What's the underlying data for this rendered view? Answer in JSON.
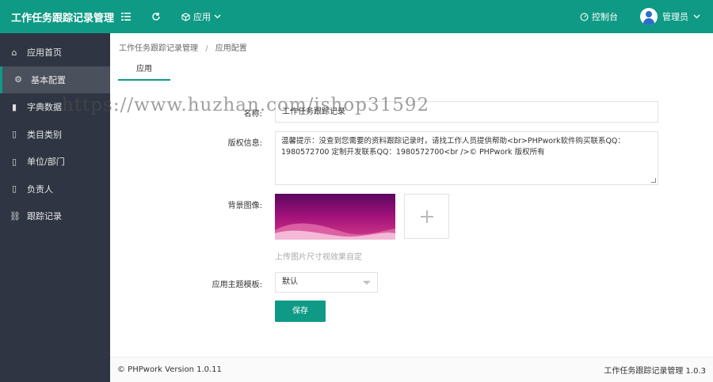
{
  "app": {
    "title": "工作任务跟踪记录管理"
  },
  "topbar": {
    "app_menu_label": "应用",
    "console_label": "控制台",
    "user_label": "管理员"
  },
  "sidebar": {
    "items": [
      {
        "label": "应用首页",
        "icon": "home-icon"
      },
      {
        "label": "基本配置",
        "icon": "gear-icon",
        "active": true
      },
      {
        "label": "字典数据",
        "icon": "book-icon"
      },
      {
        "label": "类目类别",
        "icon": "file-icon"
      },
      {
        "label": "单位/部门",
        "icon": "file-icon"
      },
      {
        "label": "负责人",
        "icon": "file-icon"
      },
      {
        "label": "跟踪记录",
        "icon": "link-icon"
      }
    ]
  },
  "breadcrumb": {
    "root": "工作任务跟踪记录管理",
    "separator": "/",
    "current": "应用配置"
  },
  "tabs": [
    {
      "label": "应用"
    }
  ],
  "form": {
    "name_label": "名称:",
    "name_value": "工作任务跟踪记录",
    "copyright_label": "版权信息:",
    "copyright_value": "温馨提示：没查到您需要的资料跟踪记录时，请找工作人员提供帮助<br>PHPwork软件购买联系QQ：1980572700 定制开发联系QQ：1980572700<br />© PHPwork 版权所有",
    "bg_label": "背景图像:",
    "upload_hint": "上传图片尺寸视效果自定",
    "theme_label": "应用主题模板:",
    "theme_value": "默认",
    "save_label": "保存"
  },
  "footer": {
    "left": "© PHPwork Version 1.0.11",
    "right": "工作任务跟踪记录管理 1.0.3"
  },
  "watermark": "https://www.huzhan.com/ishop31592",
  "colors": {
    "primary": "#0f9a85",
    "sidebar": "#2f3542",
    "sidebar_active": "#4a505c"
  }
}
